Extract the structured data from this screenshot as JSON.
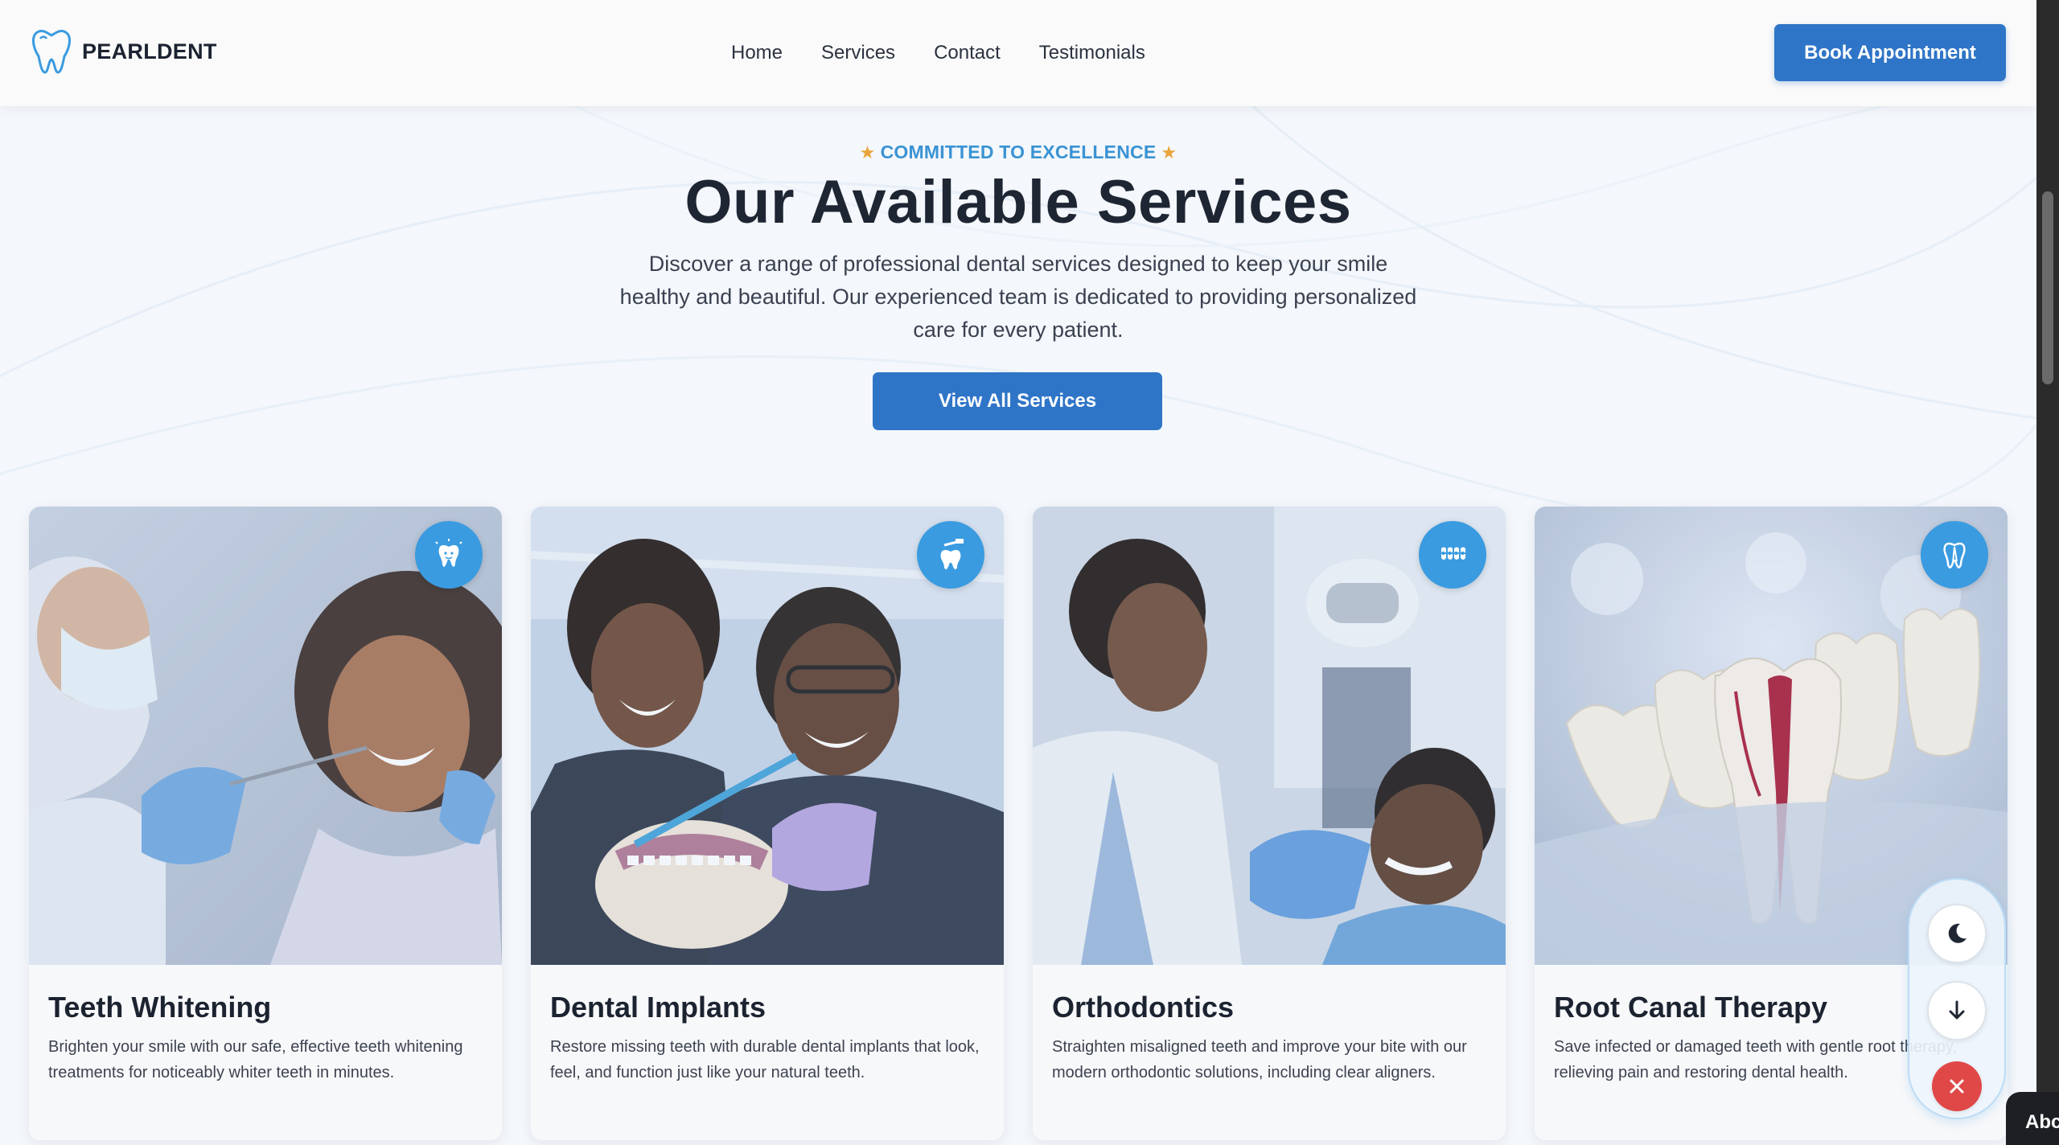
{
  "brand": {
    "name": "PEARLDENT",
    "color": "#2f75c7"
  },
  "nav": {
    "links": [
      "Home",
      "Services",
      "Contact",
      "Testimonials"
    ],
    "cta": "Book Appointment"
  },
  "hero": {
    "eyebrow": "COMMITTED TO EXCELLENCE",
    "title": "Our Available Services",
    "description": "Discover a range of professional dental services designed to keep your smile healthy and beautiful. Our experienced team is dedicated to providing personalized care for every patient.",
    "button": "View All Services"
  },
  "services": [
    {
      "title": "Teeth Whitening",
      "description": "Brighten your smile with our safe, effective teeth whitening treatments for noticeably whiter teeth in minutes.",
      "icon": "sparkling-tooth-icon"
    },
    {
      "title": "Dental Implants",
      "description": "Restore missing teeth with durable dental implants that look, feel, and function just like your natural teeth.",
      "icon": "tooth-brush-icon"
    },
    {
      "title": "Orthodontics",
      "description": "Straighten misaligned teeth and improve your bite with our modern orthodontic solutions, including clear aligners.",
      "icon": "braces-icon"
    },
    {
      "title": "Root Canal Therapy",
      "description": "Save infected or damaged teeth with gentle root therapy, relieving pain and restoring dental health.",
      "icon": "tooth-root-icon"
    }
  ],
  "floating_controls": [
    "moon-icon",
    "arrow-down-icon",
    "close-icon"
  ],
  "corner_chip": "Abc",
  "colors": {
    "accent": "#3a9be0",
    "primary": "#2f75c7",
    "star": "#e9a43a",
    "danger": "#e04848"
  }
}
